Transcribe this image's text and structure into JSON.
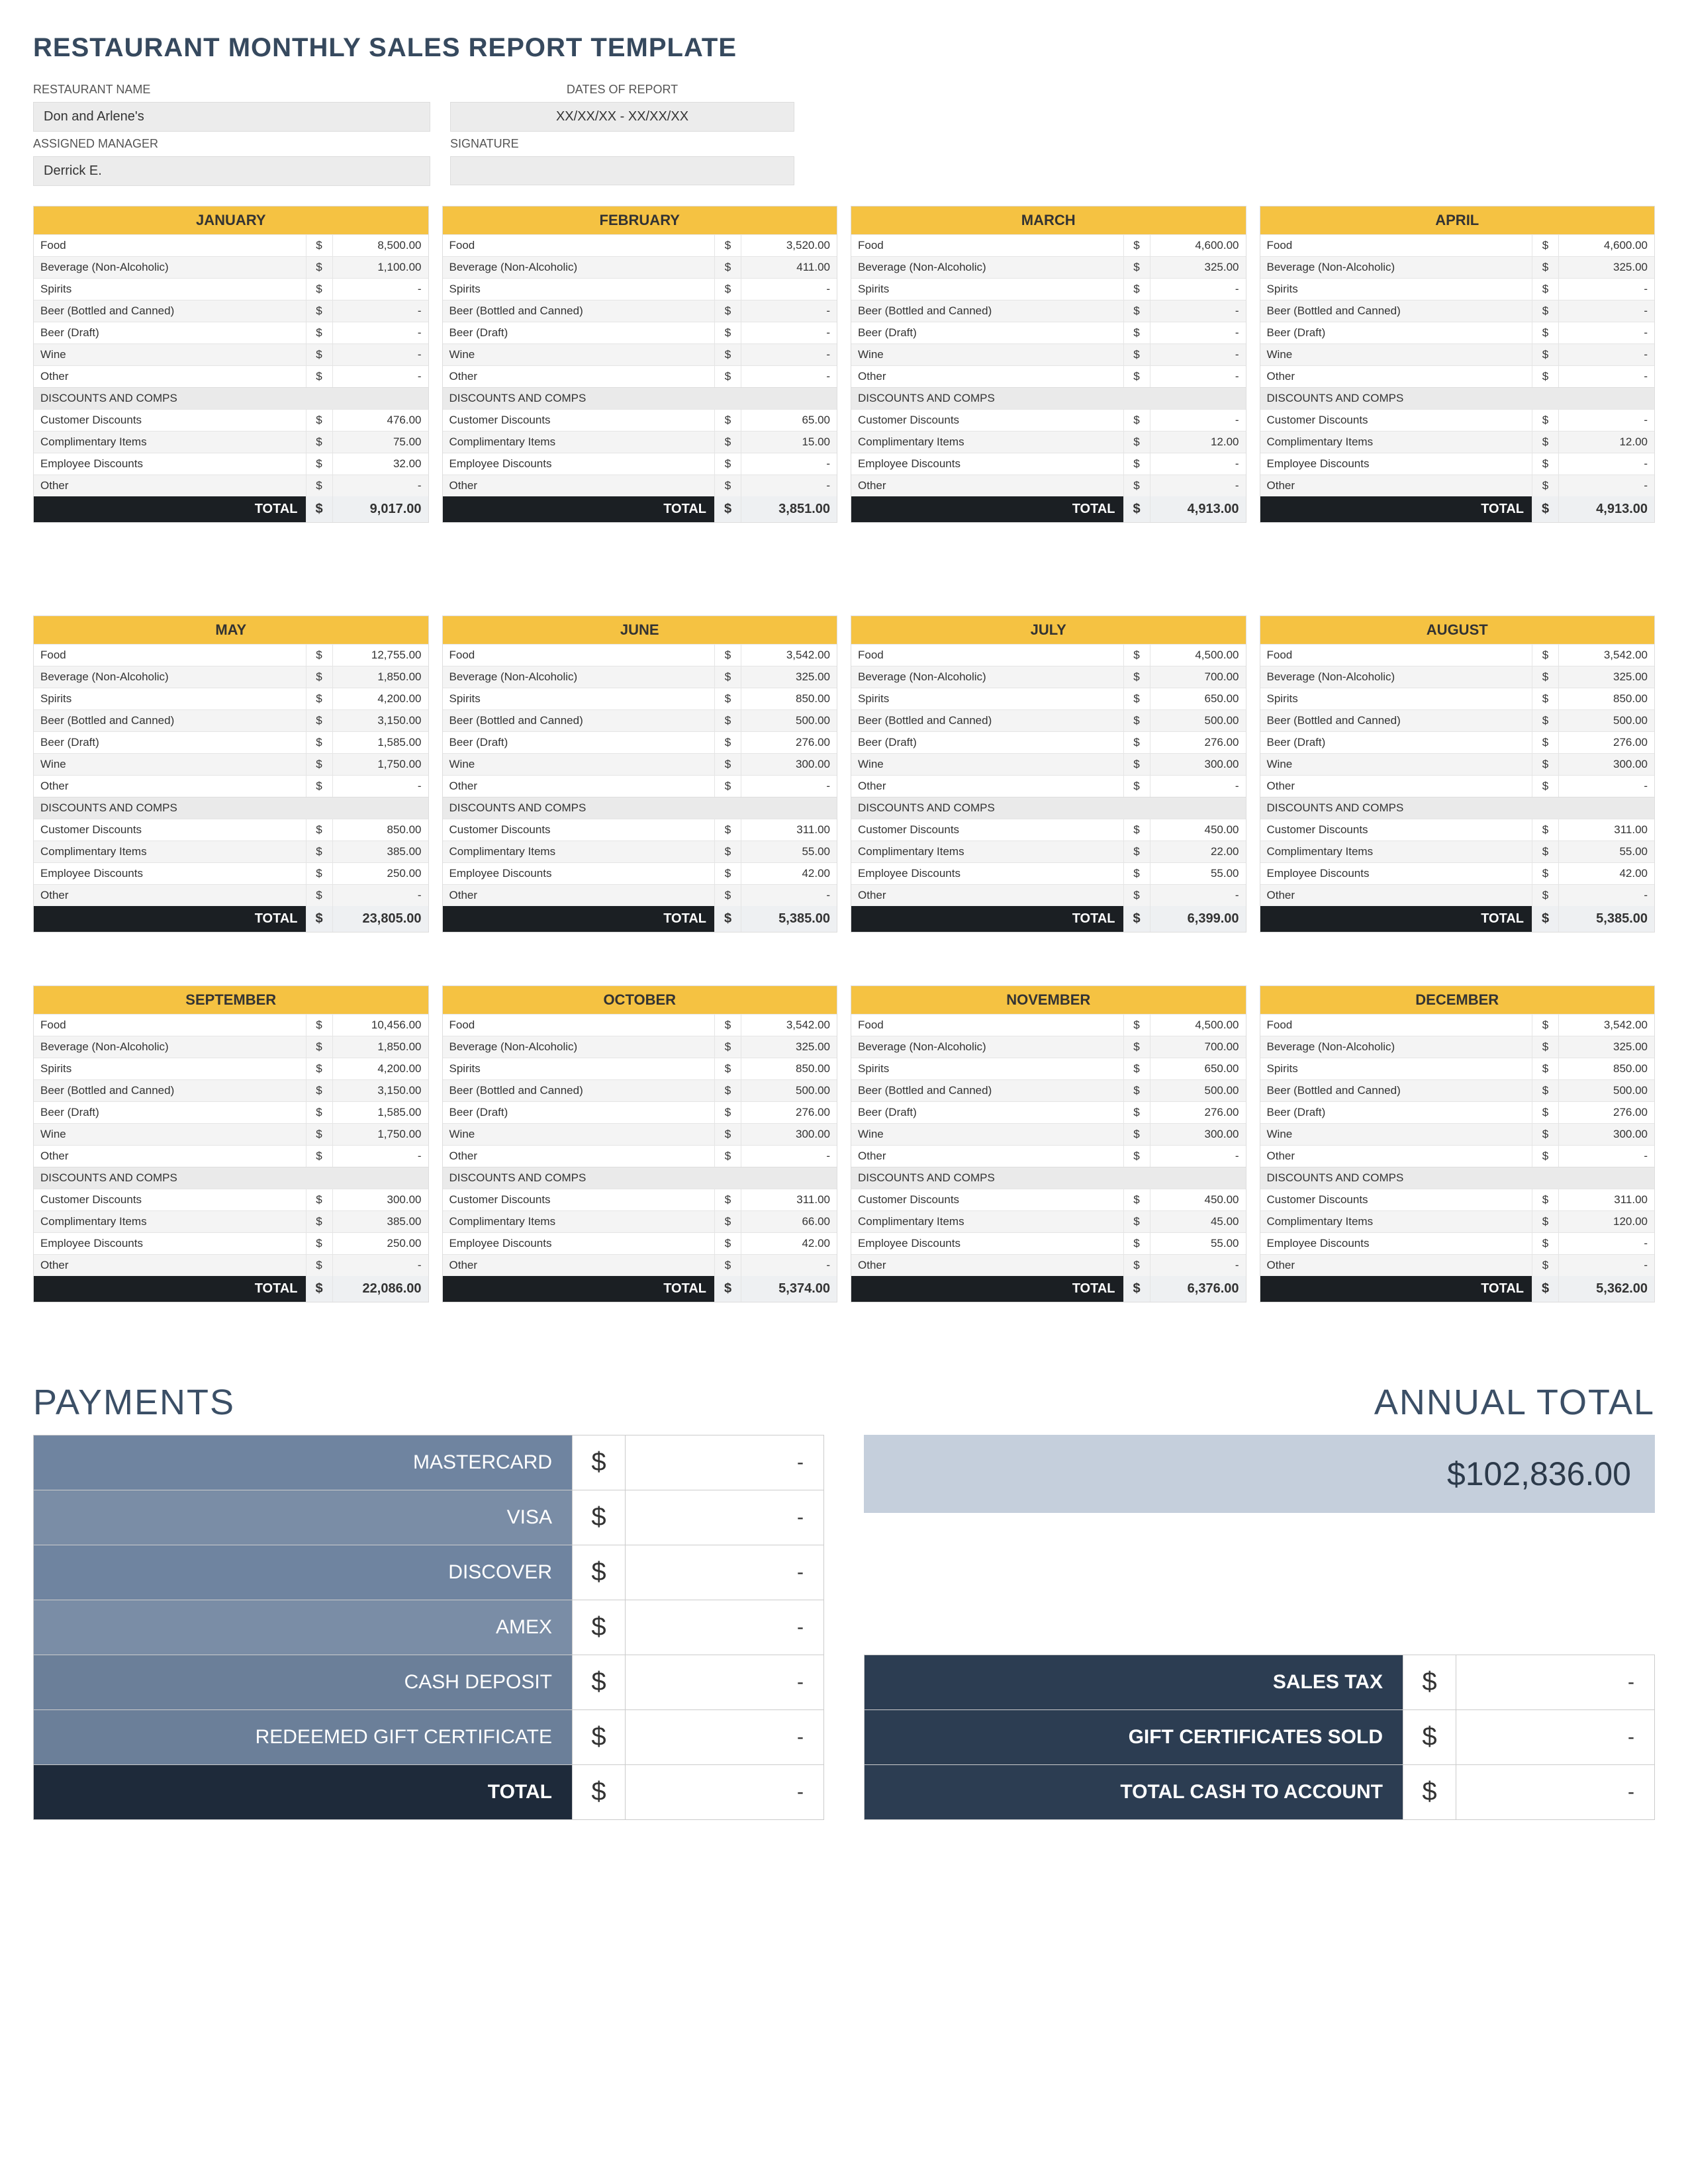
{
  "title": "RESTAURANT MONTHLY SALES REPORT TEMPLATE",
  "fields": {
    "restaurant_name_label": "RESTAURANT NAME",
    "restaurant_name": "Don and Arlene's",
    "assigned_manager_label": "ASSIGNED MANAGER",
    "assigned_manager": "Derrick E.",
    "dates_label": "DATES OF REPORT",
    "dates": "XX/XX/XX - XX/XX/XX",
    "signature_label": "SIGNATURE",
    "signature": ""
  },
  "cat_labels": [
    "Food",
    "Beverage (Non-Alcoholic)",
    "Spirits",
    "Beer (Bottled and Canned)",
    "Beer (Draft)",
    "Wine",
    "Other"
  ],
  "disc_header": "DISCOUNTS AND COMPS",
  "disc_labels": [
    "Customer Discounts",
    "Complimentary Items",
    "Employee Discounts",
    "Other"
  ],
  "total_label": "TOTAL",
  "months": [
    {
      "name": "JANUARY",
      "cats": [
        "8,500.00",
        "1,100.00",
        "-",
        "-",
        "-",
        "-",
        "-"
      ],
      "discs": [
        "476.00",
        "75.00",
        "32.00",
        "-"
      ],
      "total": "9,017.00"
    },
    {
      "name": "FEBRUARY",
      "cats": [
        "3,520.00",
        "411.00",
        "-",
        "-",
        "-",
        "-",
        "-"
      ],
      "discs": [
        "65.00",
        "15.00",
        "-",
        "-"
      ],
      "total": "3,851.00"
    },
    {
      "name": "MARCH",
      "cats": [
        "4,600.00",
        "325.00",
        "-",
        "-",
        "-",
        "-",
        "-"
      ],
      "discs": [
        "-",
        "12.00",
        "-",
        "-"
      ],
      "total": "4,913.00"
    },
    {
      "name": "APRIL",
      "cats": [
        "4,600.00",
        "325.00",
        "-",
        "-",
        "-",
        "-",
        "-"
      ],
      "discs": [
        "-",
        "12.00",
        "-",
        "-"
      ],
      "total": "4,913.00"
    },
    {
      "name": "MAY",
      "cats": [
        "12,755.00",
        "1,850.00",
        "4,200.00",
        "3,150.00",
        "1,585.00",
        "1,750.00",
        "-"
      ],
      "discs": [
        "850.00",
        "385.00",
        "250.00",
        "-"
      ],
      "total": "23,805.00"
    },
    {
      "name": "JUNE",
      "cats": [
        "3,542.00",
        "325.00",
        "850.00",
        "500.00",
        "276.00",
        "300.00",
        "-"
      ],
      "discs": [
        "311.00",
        "55.00",
        "42.00",
        "-"
      ],
      "total": "5,385.00"
    },
    {
      "name": "JULY",
      "cats": [
        "4,500.00",
        "700.00",
        "650.00",
        "500.00",
        "276.00",
        "300.00",
        "-"
      ],
      "discs": [
        "450.00",
        "22.00",
        "55.00",
        "-"
      ],
      "total": "6,399.00"
    },
    {
      "name": "AUGUST",
      "cats": [
        "3,542.00",
        "325.00",
        "850.00",
        "500.00",
        "276.00",
        "300.00",
        "-"
      ],
      "discs": [
        "311.00",
        "55.00",
        "42.00",
        "-"
      ],
      "total": "5,385.00"
    },
    {
      "name": "SEPTEMBER",
      "cats": [
        "10,456.00",
        "1,850.00",
        "4,200.00",
        "3,150.00",
        "1,585.00",
        "1,750.00",
        "-"
      ],
      "discs": [
        "300.00",
        "385.00",
        "250.00",
        "-"
      ],
      "total": "22,086.00"
    },
    {
      "name": "OCTOBER",
      "cats": [
        "3,542.00",
        "325.00",
        "850.00",
        "500.00",
        "276.00",
        "300.00",
        "-"
      ],
      "discs": [
        "311.00",
        "66.00",
        "42.00",
        "-"
      ],
      "total": "5,374.00"
    },
    {
      "name": "NOVEMBER",
      "cats": [
        "4,500.00",
        "700.00",
        "650.00",
        "500.00",
        "276.00",
        "300.00",
        "-"
      ],
      "discs": [
        "450.00",
        "45.00",
        "55.00",
        "-"
      ],
      "total": "6,376.00"
    },
    {
      "name": "DECEMBER",
      "cats": [
        "3,542.00",
        "325.00",
        "850.00",
        "500.00",
        "276.00",
        "300.00",
        "-"
      ],
      "discs": [
        "311.00",
        "120.00",
        "-",
        "-"
      ],
      "total": "5,362.00"
    }
  ],
  "payments": {
    "header": "PAYMENTS",
    "rows": [
      {
        "label": "MASTERCARD",
        "val": "-"
      },
      {
        "label": "VISA",
        "val": "-"
      },
      {
        "label": "DISCOVER",
        "val": "-"
      },
      {
        "label": "AMEX",
        "val": "-"
      },
      {
        "label": "CASH DEPOSIT",
        "val": "-"
      },
      {
        "label": "REDEEMED GIFT CERTIFICATE",
        "val": "-"
      }
    ],
    "total_label": "TOTAL",
    "total": "-"
  },
  "annual": {
    "header": "ANNUAL TOTAL",
    "value": "$102,836.00"
  },
  "summary": [
    {
      "label": "SALES TAX",
      "val": "-"
    },
    {
      "label": "GIFT CERTIFICATES SOLD",
      "val": "-"
    },
    {
      "label": "TOTAL CASH TO ACCOUNT",
      "val": "-"
    }
  ]
}
